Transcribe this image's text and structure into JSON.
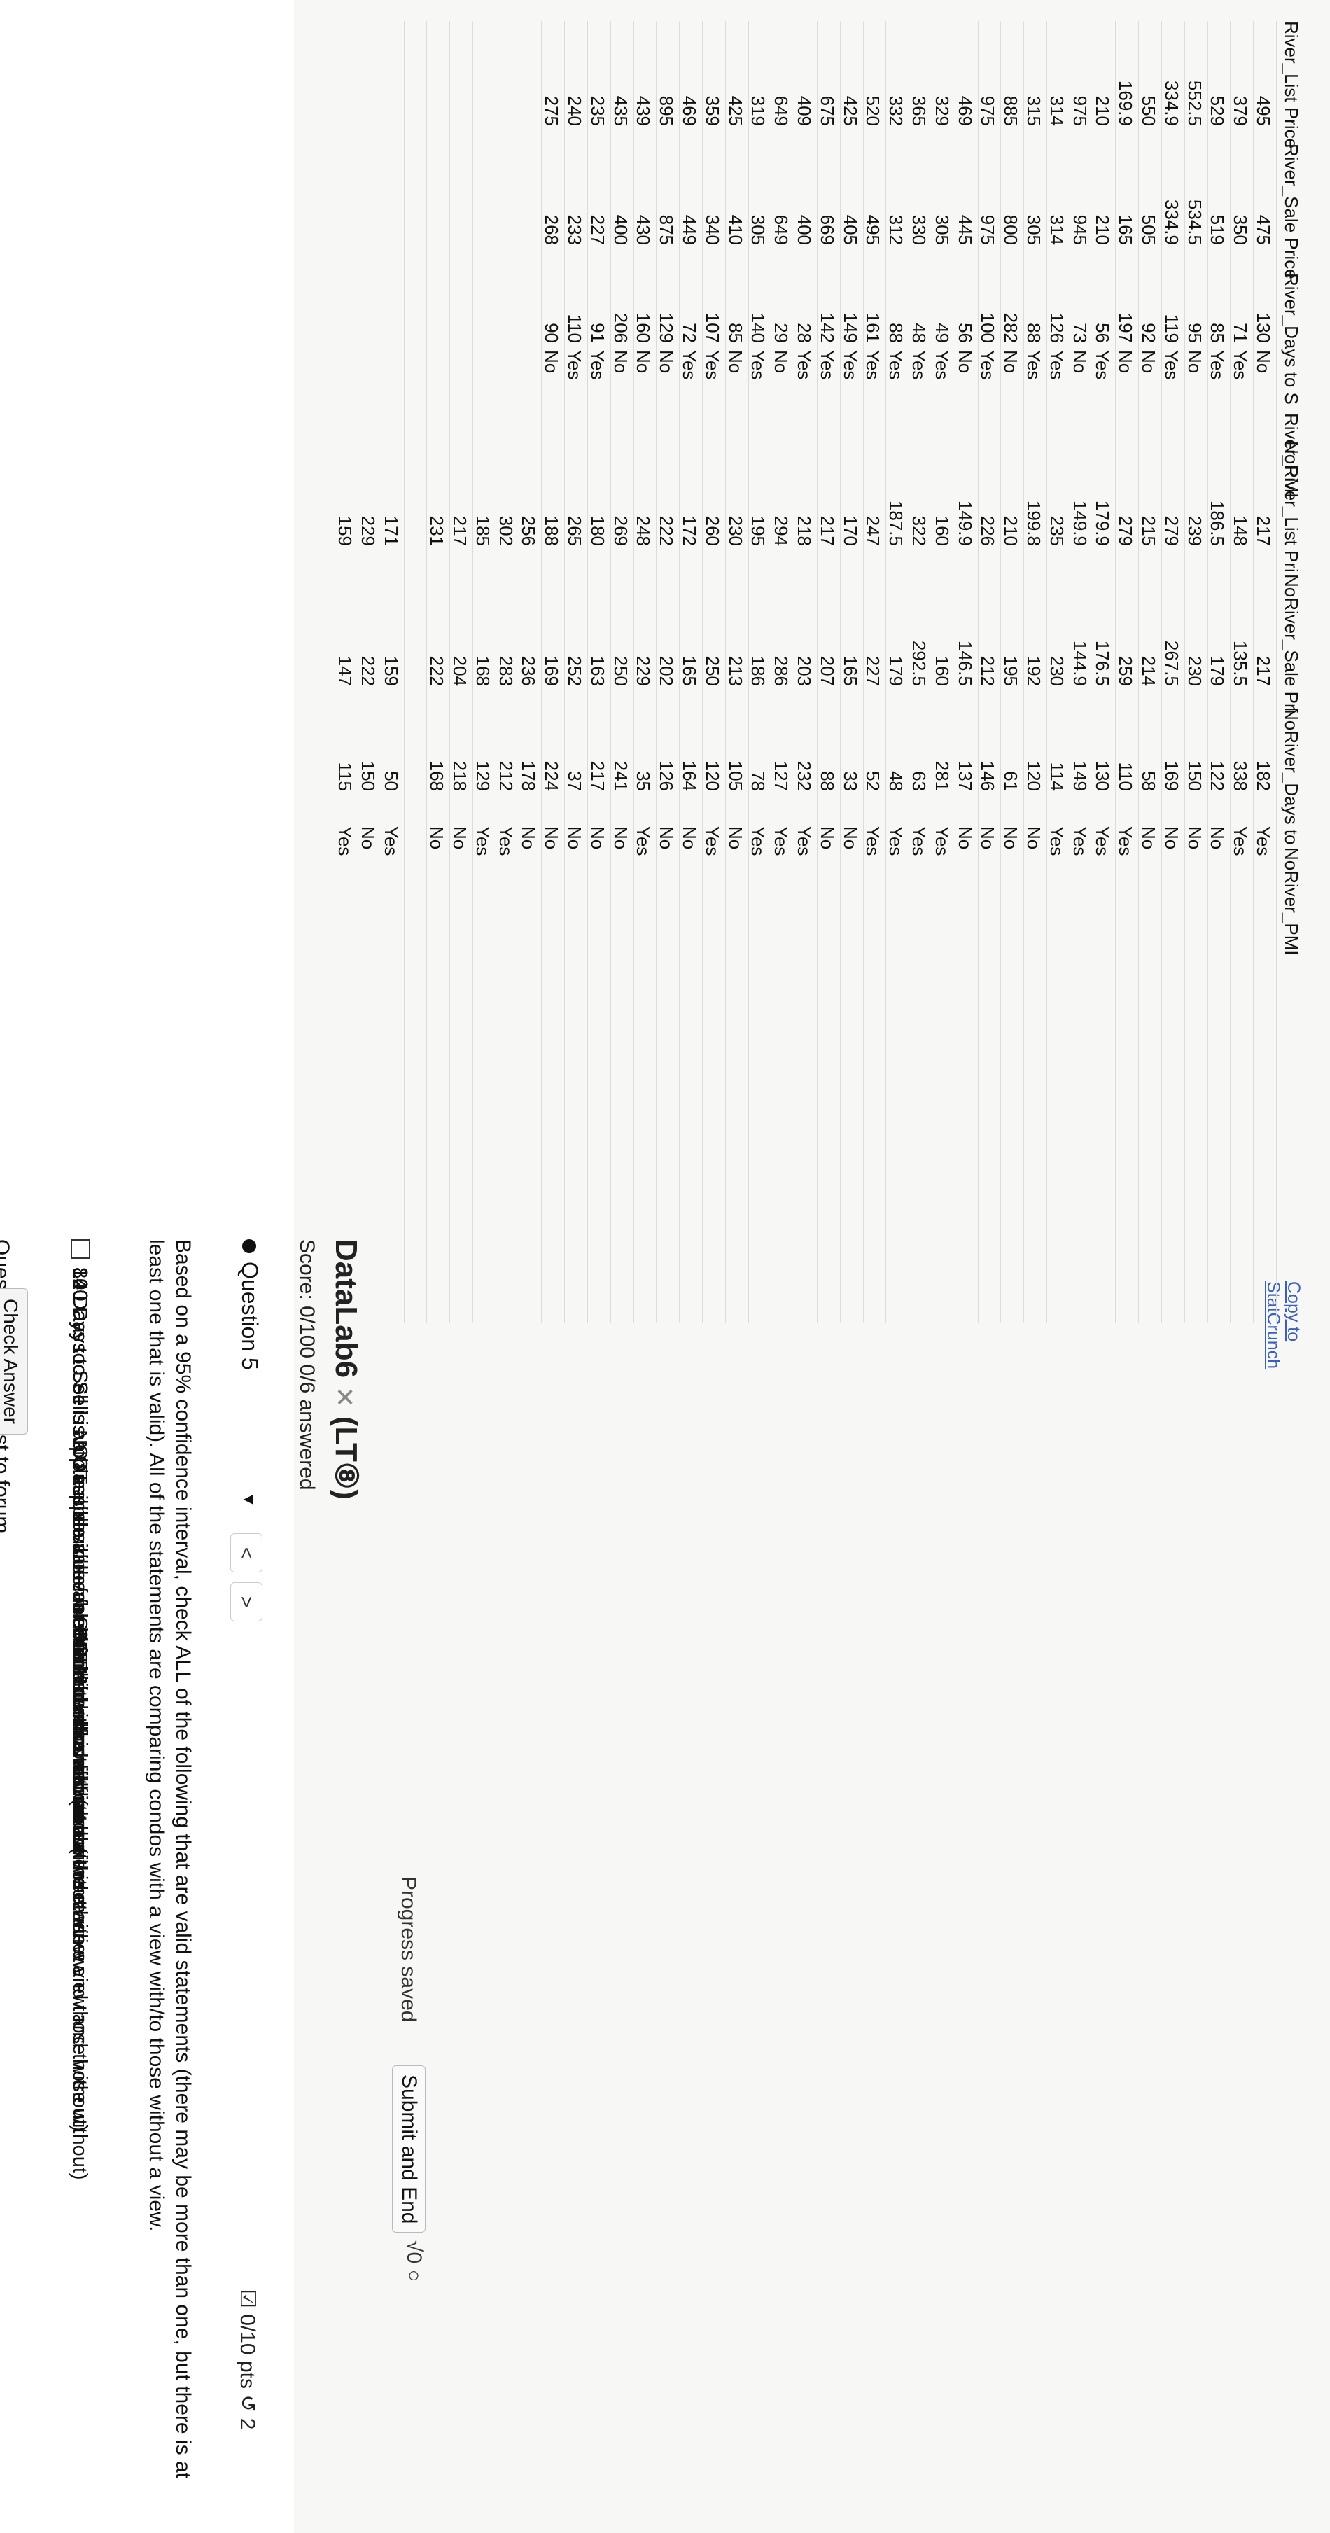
{
  "sheet": {
    "copy_link": "Copy to StatCrunch",
    "headers": [
      "River_List Price",
      "River_Sale Price",
      "River_Days to S",
      "River_PMI",
      "NoRiver_List Pri",
      "NoRiver_Sale Pri",
      "NoRiver_Days to",
      "NoRiver_PMI"
    ],
    "rows": [
      [
        "495",
        "475",
        "130",
        "No",
        "217",
        "217",
        "182",
        "Yes"
      ],
      [
        "379",
        "350",
        "71",
        "Yes",
        "148",
        "135.5",
        "338",
        "Yes"
      ],
      [
        "529",
        "519",
        "85",
        "Yes",
        "186.5",
        "179",
        "122",
        "No"
      ],
      [
        "552.5",
        "534.5",
        "95",
        "No",
        "239",
        "230",
        "150",
        "No"
      ],
      [
        "334.9",
        "334.9",
        "119",
        "Yes",
        "279",
        "267.5",
        "169",
        "No"
      ],
      [
        "550",
        "505",
        "92",
        "No",
        "215",
        "214",
        "58",
        "No"
      ],
      [
        "169.9",
        "165",
        "197",
        "No",
        "279",
        "259",
        "110",
        "Yes"
      ],
      [
        "210",
        "210",
        "56",
        "Yes",
        "179.9",
        "176.5",
        "130",
        "Yes"
      ],
      [
        "975",
        "945",
        "73",
        "No",
        "149.9",
        "144.9",
        "149",
        "Yes"
      ],
      [
        "314",
        "314",
        "126",
        "Yes",
        "235",
        "230",
        "114",
        "Yes"
      ],
      [
        "315",
        "305",
        "88",
        "Yes",
        "199.8",
        "192",
        "120",
        "No"
      ],
      [
        "885",
        "800",
        "282",
        "No",
        "210",
        "195",
        "61",
        "No"
      ],
      [
        "975",
        "975",
        "100",
        "Yes",
        "226",
        "212",
        "146",
        "No"
      ],
      [
        "469",
        "445",
        "56",
        "No",
        "149.9",
        "146.5",
        "137",
        "No"
      ],
      [
        "329",
        "305",
        "49",
        "Yes",
        "160",
        "160",
        "281",
        "Yes"
      ],
      [
        "365",
        "330",
        "48",
        "Yes",
        "322",
        "292.5",
        "63",
        "Yes"
      ],
      [
        "332",
        "312",
        "88",
        "Yes",
        "187.5",
        "179",
        "48",
        "Yes"
      ],
      [
        "520",
        "495",
        "161",
        "Yes",
        "247",
        "227",
        "52",
        "Yes"
      ],
      [
        "425",
        "405",
        "149",
        "Yes",
        "170",
        "165",
        "33",
        "No"
      ],
      [
        "675",
        "669",
        "142",
        "Yes",
        "217",
        "207",
        "88",
        "No"
      ],
      [
        "409",
        "400",
        "28",
        "Yes",
        "218",
        "203",
        "232",
        "Yes"
      ],
      [
        "649",
        "649",
        "29",
        "No",
        "294",
        "286",
        "127",
        "Yes"
      ],
      [
        "319",
        "305",
        "140",
        "Yes",
        "195",
        "186",
        "78",
        "Yes"
      ],
      [
        "425",
        "410",
        "85",
        "No",
        "230",
        "213",
        "105",
        "No"
      ],
      [
        "359",
        "340",
        "107",
        "Yes",
        "260",
        "250",
        "120",
        "Yes"
      ],
      [
        "469",
        "449",
        "72",
        "Yes",
        "172",
        "165",
        "164",
        "No"
      ],
      [
        "895",
        "875",
        "129",
        "No",
        "222",
        "202",
        "126",
        "No"
      ],
      [
        "439",
        "430",
        "160",
        "No",
        "248",
        "229",
        "35",
        "Yes"
      ],
      [
        "435",
        "400",
        "206",
        "No",
        "269",
        "250",
        "241",
        "No"
      ],
      [
        "235",
        "227",
        "91",
        "Yes",
        "180",
        "163",
        "217",
        "No"
      ],
      [
        "240",
        "233",
        "110",
        "Yes",
        "265",
        "252",
        "37",
        "No"
      ],
      [
        "275",
        "268",
        "90",
        "No",
        "188",
        "169",
        "224",
        "No"
      ],
      [
        "",
        "",
        "",
        "",
        "256",
        "236",
        "178",
        "No"
      ],
      [
        "",
        "",
        "",
        "",
        "302",
        "283",
        "212",
        "Yes"
      ],
      [
        "",
        "",
        "",
        "",
        "185",
        "168",
        "129",
        "Yes"
      ],
      [
        "",
        "",
        "",
        "",
        "217",
        "204",
        "218",
        "No"
      ],
      [
        "",
        "",
        "",
        "",
        "231",
        "222",
        "168",
        "No"
      ],
      [
        "",
        "",
        "",
        "",
        "",
        "",
        "",
        ""
      ],
      [
        "",
        "",
        "",
        "",
        "171",
        "159",
        "50",
        "Yes"
      ],
      [
        "",
        "",
        "",
        "",
        "229",
        "222",
        "150",
        "No"
      ],
      [
        "",
        "",
        "",
        "",
        "159",
        "147",
        "115",
        "Yes"
      ]
    ]
  },
  "quiz": {
    "title": "DataLab6",
    "title_suffix": "(LT⑧)",
    "score": "Score: 0/100   0/6 answered",
    "progress": "Progress saved",
    "submit": "Submit and End",
    "tools": "√0 ○",
    "question_label": "Question 5",
    "points": "☑ 0/10 pts ↺ 2",
    "prompt": "Based on a 95% confidence interval, check ALL of the following that are valid statements (there may be more than one, but there is at least one that is valid). All of the statements are comparing condos with a view with/to those without a view.",
    "options": [
      "80 Days to Sell is a plausible value for ONE kind of condo but not the other.",
      "120 Days to Sell is a plausible value for ONLY condos without a view.",
      "80 Days to Sell is a plausible value for either kind of condo (those with a view and those without)",
      "140 Days to Sell is a plausible value for condos without a view",
      "120 Days to Sell is a plausible value for ONLY condos with a view.",
      "80 Days to Sell is NOT a plausible value for either kind of condo (those with a view and those without)",
      "140 Days to Sell is a plausible value for condos with a view",
      "140 Days to Sell is NOT a plausible value for either kind of condo",
      "120 Days to Sell is a plausible value for BOTH condos with and without a view."
    ],
    "help": "Question Help:   ☐ Post to forum",
    "check": "Check Answer"
  }
}
